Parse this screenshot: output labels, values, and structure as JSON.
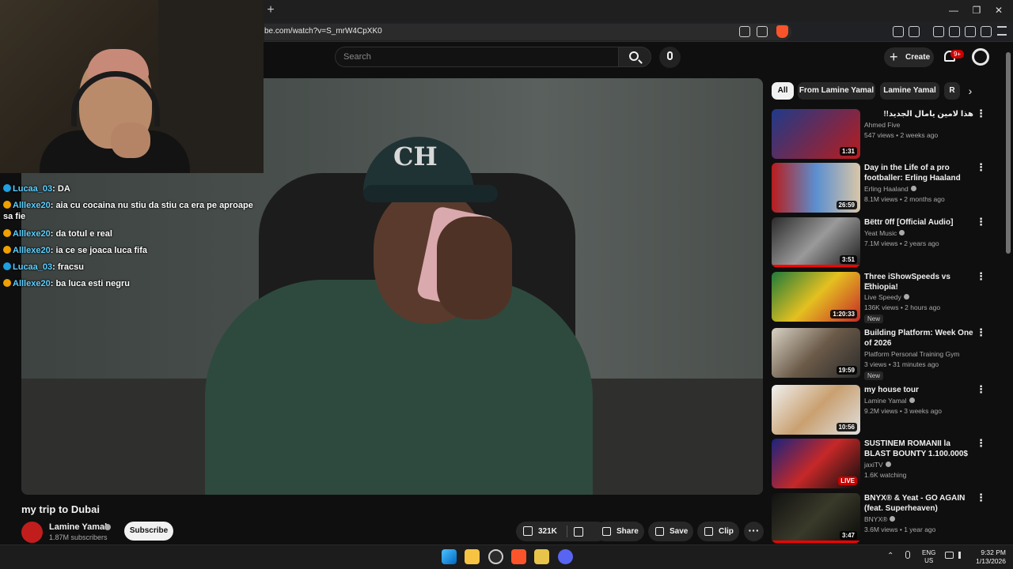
{
  "browser": {
    "url": "be.com/watch?v=S_mrW4CpXK0",
    "new_tab": "+",
    "window_min": "—",
    "window_restore": "❐",
    "window_close": "✕"
  },
  "header": {
    "search_placeholder": "Search",
    "create_label": "Create",
    "create_plus": "+",
    "notif_count": "9+"
  },
  "chat": [
    {
      "user": "Lucaa_03",
      "text": "DA",
      "badge_color": "#1fa0e0"
    },
    {
      "user": "Alllexe20",
      "text": "aia cu cocaina nu stiu da stiu ca era pe aproape sa fie",
      "badge_color": "#f0a000"
    },
    {
      "user": "Alllexe20",
      "text": "da totul e real",
      "badge_color": "#f0a000"
    },
    {
      "user": "Alllexe20",
      "text": "ia ce se joaca luca fifa",
      "badge_color": "#f0a000"
    },
    {
      "user": "Lucaa_03",
      "text": "fracsu",
      "badge_color": "#1fa0e0"
    },
    {
      "user": "Alllexe20",
      "text": "ba luca esti negru",
      "badge_color": "#f0a000"
    }
  ],
  "video": {
    "title": "my trip to Dubai",
    "cap_logo": "CH",
    "channel": "Lamine Yamal",
    "subscribers": "1.87M subscribers",
    "subscribe_label": "Subscribe",
    "likes": "321K",
    "share_label": "Share",
    "save_label": "Save",
    "clip_label": "Clip",
    "more_label": "···"
  },
  "chips": [
    "All",
    "From Lamine Yamal",
    "Lamine Yamal",
    "R"
  ],
  "chip_next": "›",
  "recommendations": [
    {
      "title": "هذا لامين يامال الجديد!!",
      "channel": "Ahmed Five",
      "meta": "547 views • 2 weeks ago",
      "duration": "1:31",
      "verified": false,
      "badge": "",
      "thumb": "linear-gradient(135deg,#1e3a8a,#b91c1c)"
    },
    {
      "title": "Day in the Life of a pro footballer: Erling Haaland",
      "channel": "Erling Haaland",
      "meta": "8.1M views • 2 months ago",
      "duration": "26:59",
      "verified": true,
      "badge": "",
      "thumb": "linear-gradient(90deg,#b91c1c,#5b8fd0,#d9c6a8)"
    },
    {
      "title": "Bëttr 0ff [Official Audio]",
      "channel": "Yeat Music",
      "meta": "7.1M views • 2 years ago",
      "duration": "3:51",
      "verified": true,
      "badge": "",
      "thumb": "linear-gradient(135deg,#2b2b2b,#9a9a9a,#1a1a1a)",
      "progress": 1.0
    },
    {
      "title": "Three iShowSpeeds vs Ethiopia!",
      "channel": "Live Speedy",
      "channel_sub": "ET",
      "meta": "136K views • 2 hours ago",
      "duration": "1:20:33",
      "verified": true,
      "badge": "New",
      "thumb": "linear-gradient(135deg,#1f7a3a,#e4c020,#c62828)"
    },
    {
      "title": "Building Platform: Week One of 2026",
      "channel": "Platform Personal Training Gym",
      "meta": "3 views • 31 minutes ago",
      "duration": "19:59",
      "verified": false,
      "badge": "New",
      "thumb": "linear-gradient(135deg,#d8d2c4,#6b5a48,#2b2b2b)"
    },
    {
      "title": "my house tour",
      "channel": "Lamine Yamal",
      "meta": "9.2M views • 3 weeks ago",
      "duration": "10:56",
      "verified": true,
      "badge": "",
      "thumb": "linear-gradient(135deg,#f0f0f0,#c9a070,#e0e0e0)"
    },
    {
      "title": "SUSTINEM ROMANII la BLAST BOUNTY 1.100.000$",
      "channel": "jaxiTV",
      "meta": "1.6K watching",
      "duration": "LIVE",
      "verified": true,
      "badge": "",
      "thumb": "linear-gradient(135deg,#1a237e,#c62828,#0d0d0d)"
    },
    {
      "title": "BNYX® & Yeat - GO AGAIN (feat. Superheaven)",
      "channel": "BNYX®",
      "meta": "3.6M views • 1 year ago",
      "duration": "3:47",
      "verified": true,
      "badge": "",
      "thumb": "linear-gradient(135deg,#111,#3a3a2a,#0a0a0a)",
      "progress": 1.0
    }
  ],
  "taskbar": {
    "lang": "ENG",
    "region": "US",
    "time": "9:32 PM",
    "date": "1/13/2026"
  },
  "colors": {
    "accent_red": "#ff0000",
    "background": "#0f0f0f"
  }
}
